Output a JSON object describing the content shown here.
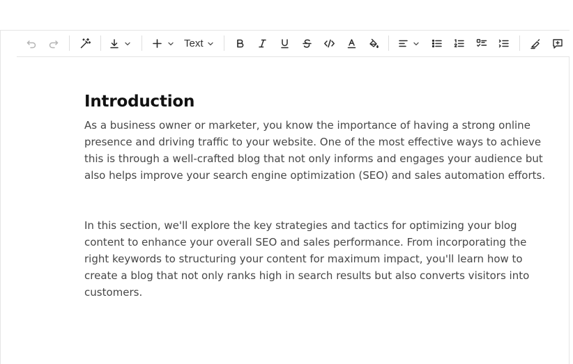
{
  "toolbar": {
    "undo_icon": "undo-icon",
    "redo_icon": "redo-icon",
    "ai_icon": "magic-wand-icon",
    "export_icon": "download-icon",
    "insert_icon": "plus-icon",
    "block_type": "Text",
    "format_icons": [
      "bold-icon",
      "italic-icon",
      "underline-icon",
      "strikethrough-icon",
      "code-icon",
      "text-color-icon",
      "highlight-icon"
    ],
    "align_icon": "align-left-icon",
    "list_icons": [
      "bullet-list-icon",
      "ordered-list-icon",
      "task-list-icon",
      "numbered-list-icon"
    ],
    "extra_icons": [
      "clear-format-icon",
      "add-comment-icon"
    ]
  },
  "document": {
    "heading": "Introduction",
    "paragraphs": [
      "As a business owner or marketer, you know the importance of having a strong online presence and driving traffic to your website. One of the most effective ways to achieve this is through a well-crafted blog that not only informs and engages your audience but also helps improve your search engine optimization (SEO) and sales automation efforts.",
      "In this section, we'll explore the key strategies and tactics for optimizing your blog content to enhance your overall SEO and sales performance. From incorporating the right keywords to structuring your content for maximum impact, you'll learn how to create a blog that not only ranks high in search results but also converts visitors into customers."
    ]
  },
  "colors": {
    "text": "#464646",
    "heading": "#111111",
    "border": "#e3e3e3",
    "disabled": "#b5b5b5"
  }
}
